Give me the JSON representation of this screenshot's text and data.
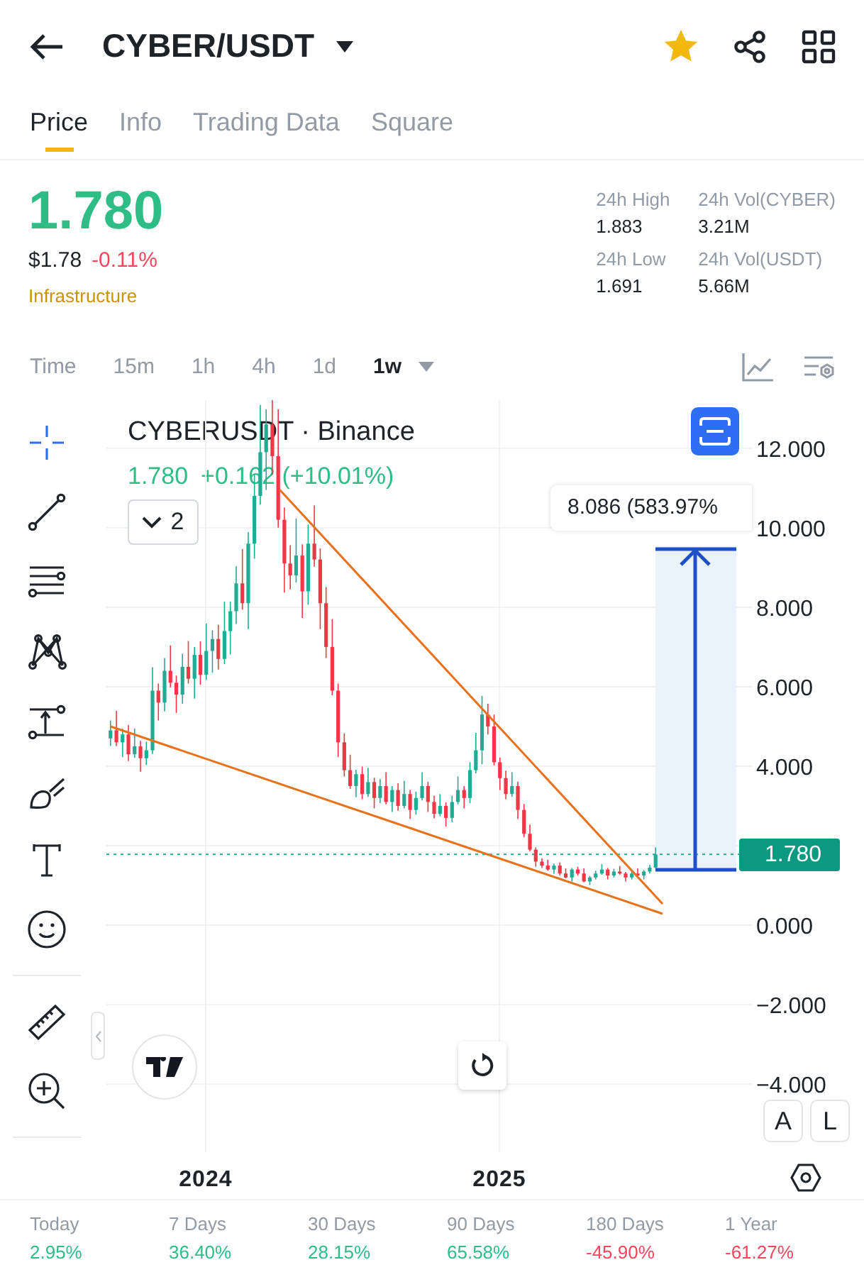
{
  "header": {
    "title": "CYBER/USDT",
    "favorite": true
  },
  "tabs": [
    {
      "label": "Price",
      "selected": true
    },
    {
      "label": "Info",
      "selected": false
    },
    {
      "label": "Trading Data",
      "selected": false
    },
    {
      "label": "Square",
      "selected": false
    }
  ],
  "summary": {
    "price": "1.780",
    "fiat": "$1.78",
    "change": {
      "text": "-0.11%",
      "color": "#f6465d"
    },
    "tag": "Infrastructure",
    "stats": [
      {
        "label": "24h High",
        "value": "1.883"
      },
      {
        "label": "24h Vol(CYBER)",
        "value": "3.21M"
      },
      {
        "label": "24h Low",
        "value": "1.691"
      },
      {
        "label": "24h Vol(USDT)",
        "value": "5.66M"
      }
    ]
  },
  "intervals": [
    {
      "label": "Time",
      "selected": false
    },
    {
      "label": "15m",
      "selected": false
    },
    {
      "label": "1h",
      "selected": false
    },
    {
      "label": "4h",
      "selected": false
    },
    {
      "label": "1d",
      "selected": false
    },
    {
      "label": "1w",
      "selected": true
    }
  ],
  "tools": [
    {
      "kind": "crosshair",
      "selected": true
    },
    {
      "kind": "line",
      "selected": false
    },
    {
      "kind": "lines",
      "selected": false
    },
    {
      "kind": "pattern",
      "selected": false
    },
    {
      "kind": "measure",
      "selected": false
    },
    {
      "kind": "brush",
      "selected": false
    },
    {
      "kind": "text",
      "selected": false
    },
    {
      "kind": "emoji",
      "selected": false
    },
    {
      "kind": "divider"
    },
    {
      "kind": "ruler",
      "selected": false
    },
    {
      "kind": "zoom",
      "selected": false
    },
    {
      "kind": "divider"
    }
  ],
  "chart": {
    "symbol": "CYBERUSDT · Binance",
    "last": "1.780",
    "change": "+0.162 (+10.01%)",
    "indicators": "2",
    "measure_label": "8.086 (583.97%",
    "price_tag": "1.780",
    "scale_buttons": [
      "A",
      "L"
    ],
    "chart_data": {
      "type": "candlestick",
      "xlim": [
        2023.662,
        2025.86
      ],
      "ylim": [
        -5.71,
        13.21
      ],
      "grid": true,
      "ref_lines": [
        {
          "axis": "y",
          "value": 1.78,
          "color": "#22ab94"
        }
      ],
      "x": [
        2023.676,
        2023.696,
        2023.717,
        2023.737,
        2023.758,
        2023.778,
        2023.798,
        2023.819,
        2023.839,
        2023.86,
        2023.88,
        2023.9,
        2023.921,
        2023.941,
        2023.962,
        2023.982,
        2024.002,
        2024.023,
        2024.043,
        2024.064,
        2024.084,
        2024.104,
        2024.125,
        2024.145,
        2024.166,
        2024.186,
        2024.206,
        2024.227,
        2024.247,
        2024.268,
        2024.288,
        2024.308,
        2024.329,
        2024.349,
        2024.37,
        2024.39,
        2024.41,
        2024.431,
        2024.451,
        2024.472,
        2024.492,
        2024.512,
        2024.533,
        2024.553,
        2024.574,
        2024.594,
        2024.614,
        2024.635,
        2024.655,
        2024.676,
        2024.696,
        2024.716,
        2024.737,
        2024.757,
        2024.778,
        2024.798,
        2024.818,
        2024.839,
        2024.859,
        2024.88,
        2024.9,
        2024.92,
        2024.941,
        2024.961,
        2024.982,
        2025.002,
        2025.022,
        2025.043,
        2025.063,
        2025.084,
        2025.104,
        2025.124,
        2025.145,
        2025.165,
        2025.186,
        2025.206,
        2025.226,
        2025.247,
        2025.267,
        2025.288,
        2025.308,
        2025.328,
        2025.349,
        2025.369,
        2025.39,
        2025.41,
        2025.43,
        2025.451,
        2025.471,
        2025.492,
        2025.512,
        2025.532
      ],
      "ohlc": [
        [
          4.7,
          5.15,
          4.51,
          4.9
        ],
        [
          4.9,
          5.39,
          4.51,
          4.6
        ],
        [
          4.6,
          4.94,
          4.23,
          4.8
        ],
        [
          4.8,
          5.04,
          4.13,
          4.3
        ],
        [
          4.3,
          4.95,
          4.21,
          4.5
        ],
        [
          4.5,
          4.64,
          3.86,
          4.2
        ],
        [
          4.2,
          4.62,
          4.03,
          4.4
        ],
        [
          4.4,
          6.49,
          4.31,
          5.9
        ],
        [
          5.9,
          6.08,
          5.15,
          5.6
        ],
        [
          5.6,
          6.72,
          5.38,
          6.4
        ],
        [
          6.4,
          7.04,
          5.98,
          6.1
        ],
        [
          6.1,
          6.28,
          5.34,
          5.8
        ],
        [
          5.8,
          6.83,
          5.57,
          6.5
        ],
        [
          6.5,
          7.15,
          6.08,
          6.2
        ],
        [
          6.2,
          7.0,
          5.7,
          6.8
        ],
        [
          6.8,
          7.14,
          6.05,
          6.3
        ],
        [
          6.3,
          7.59,
          6.17,
          6.9
        ],
        [
          6.9,
          7.42,
          6.35,
          7.2
        ],
        [
          7.2,
          7.56,
          6.43,
          6.7
        ],
        [
          6.7,
          8.14,
          6.57,
          7.4
        ],
        [
          7.4,
          8.14,
          6.81,
          7.9
        ],
        [
          7.9,
          9.03,
          7.58,
          8.6
        ],
        [
          8.6,
          9.46,
          7.94,
          8.1
        ],
        [
          8.1,
          9.89,
          7.45,
          9.6
        ],
        [
          9.6,
          11.34,
          9.22,
          10.8
        ],
        [
          10.8,
          13.09,
          10.58,
          11.9
        ],
        [
          11.9,
          12.98,
          10.95,
          12.6
        ],
        [
          12.6,
          13.23,
          11.33,
          11.8
        ],
        [
          11.8,
          12.98,
          10.0,
          10.2
        ],
        [
          10.2,
          10.51,
          8.37,
          9.1
        ],
        [
          9.1,
          9.56,
          8.45,
          8.8
        ],
        [
          8.8,
          10.23,
          8.62,
          9.3
        ],
        [
          9.3,
          9.58,
          7.73,
          8.4
        ],
        [
          8.4,
          10.08,
          8.06,
          9.6
        ],
        [
          9.6,
          10.56,
          9.02,
          9.2
        ],
        [
          9.2,
          9.48,
          7.45,
          8.1
        ],
        [
          8.1,
          8.51,
          6.72,
          7.0
        ],
        [
          7.0,
          7.7,
          5.78,
          5.9
        ],
        [
          5.9,
          6.08,
          4.23,
          4.6
        ],
        [
          4.6,
          4.83,
          3.74,
          3.9
        ],
        [
          3.9,
          4.29,
          3.43,
          3.5
        ],
        [
          3.5,
          3.91,
          3.22,
          3.8
        ],
        [
          3.8,
          3.99,
          3.17,
          3.3
        ],
        [
          3.3,
          3.96,
          3.23,
          3.6
        ],
        [
          3.6,
          3.71,
          2.94,
          3.2
        ],
        [
          3.2,
          3.68,
          3.07,
          3.5
        ],
        [
          3.5,
          3.85,
          3.04,
          3.1
        ],
        [
          3.1,
          3.5,
          2.85,
          3.4
        ],
        [
          3.4,
          3.57,
          2.88,
          3.0
        ],
        [
          3.0,
          3.63,
          2.94,
          3.3
        ],
        [
          3.3,
          3.4,
          2.67,
          2.9
        ],
        [
          2.9,
          3.36,
          2.78,
          3.2
        ],
        [
          3.2,
          3.85,
          3.14,
          3.5
        ],
        [
          3.5,
          3.61,
          2.85,
          3.1
        ],
        [
          3.1,
          3.26,
          2.69,
          2.8
        ],
        [
          2.8,
          3.3,
          2.74,
          3.0
        ],
        [
          3.0,
          3.09,
          2.48,
          2.7
        ],
        [
          2.7,
          3.26,
          2.59,
          3.1
        ],
        [
          3.1,
          3.74,
          3.04,
          3.4
        ],
        [
          3.4,
          3.5,
          2.94,
          3.2
        ],
        [
          3.2,
          4.1,
          3.07,
          3.9
        ],
        [
          3.9,
          4.84,
          3.82,
          4.4
        ],
        [
          4.4,
          5.77,
          4.05,
          5.3
        ],
        [
          5.3,
          5.57,
          4.8,
          5.0
        ],
        [
          5.0,
          5.3,
          4.02,
          4.1
        ],
        [
          4.1,
          4.22,
          3.4,
          3.7
        ],
        [
          3.7,
          3.89,
          3.17,
          3.3
        ],
        [
          3.3,
          3.85,
          3.23,
          3.5
        ],
        [
          3.5,
          3.61,
          2.67,
          2.9
        ],
        [
          2.9,
          3.05,
          2.21,
          2.3
        ],
        [
          2.3,
          2.53,
          1.86,
          1.9
        ],
        [
          1.9,
          1.96,
          1.47,
          1.6
        ],
        [
          1.6,
          1.68,
          1.44,
          1.5
        ],
        [
          1.5,
          1.65,
          1.37,
          1.4
        ],
        [
          1.4,
          1.55,
          1.29,
          1.5
        ],
        [
          1.5,
          1.58,
          1.25,
          1.3
        ],
        [
          1.3,
          1.43,
          1.18,
          1.2
        ],
        [
          1.2,
          1.44,
          1.1,
          1.4
        ],
        [
          1.4,
          1.47,
          1.25,
          1.3
        ],
        [
          1.3,
          1.43,
          1.08,
          1.1
        ],
        [
          1.1,
          1.24,
          1.01,
          1.2
        ],
        [
          1.2,
          1.37,
          1.15,
          1.3
        ],
        [
          1.3,
          1.54,
          1.27,
          1.4
        ],
        [
          1.4,
          1.44,
          1.15,
          1.25
        ],
        [
          1.25,
          1.42,
          1.2,
          1.35
        ],
        [
          1.35,
          1.49,
          1.27,
          1.3
        ],
        [
          1.3,
          1.34,
          1.1,
          1.2
        ],
        [
          1.2,
          1.37,
          1.15,
          1.3
        ],
        [
          1.3,
          1.43,
          1.23,
          1.25
        ],
        [
          1.25,
          1.39,
          1.15,
          1.35
        ],
        [
          1.35,
          1.52,
          1.3,
          1.45
        ],
        [
          1.45,
          1.96,
          1.42,
          1.78
        ]
      ],
      "xticks": [
        {
          "value": 2024,
          "label": "2024"
        },
        {
          "value": 2025,
          "label": "2025"
        }
      ],
      "yticks": [
        {
          "value": 12,
          "label": "12.000"
        },
        {
          "value": 10,
          "label": "10.000"
        },
        {
          "value": 8,
          "label": "8.000"
        },
        {
          "value": 6,
          "label": "6.000"
        },
        {
          "value": 4,
          "label": "4.000"
        },
        {
          "value": 0,
          "label": "0.000"
        },
        {
          "value": -2,
          "label": "−2.000"
        },
        {
          "value": -4,
          "label": "−4.000"
        }
      ]
    }
  },
  "performance": [
    {
      "label": "Today",
      "value": "2.95%",
      "color": "#2ebd85"
    },
    {
      "label": "7 Days",
      "value": "36.40%",
      "color": "#2ebd85"
    },
    {
      "label": "30 Days",
      "value": "28.15%",
      "color": "#2ebd85"
    },
    {
      "label": "90 Days",
      "value": "65.58%",
      "color": "#2ebd85"
    },
    {
      "label": "180 Days",
      "value": "-45.90%",
      "color": "#f6465d"
    },
    {
      "label": "1 Year",
      "value": "-61.27%",
      "color": "#f6465d"
    }
  ]
}
